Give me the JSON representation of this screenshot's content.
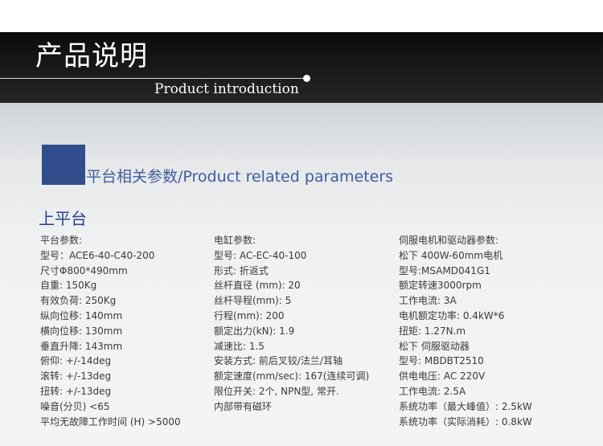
{
  "header": {
    "title_cn": "产品说明",
    "title_en": "Product introduction"
  },
  "section": {
    "title": "平台相关参数/Product related parameters",
    "subtitle": "上平台"
  },
  "columns": [
    {
      "lines": [
        "平台参数:",
        "型号：ACE6-40-C40-200",
        "尺寸Φ800*490mm",
        "自重: 150Kg",
        "有效负荷: 250Kg",
        "纵向位移: 140mm",
        "横向位移: 130mm",
        "垂直升降: 143mm",
        "俯仰: +/-14deg",
        "滚转: +/-13deg",
        "扭转: +/-13deg",
        "噪音(分贝) <65",
        "平均无故障工作时间 (H) >5000"
      ]
    },
    {
      "lines": [
        "电缸参数:",
        "型号: AC-EC-40-100",
        "形式: 折返式",
        "丝杆直径 (mm): 20",
        "丝杆导程(mm): 5",
        "行程(mm): 200",
        "额定出力(kN): 1.9",
        "减速比: 1.5",
        "安装方式: 前后叉铰/法兰/耳轴",
        "额定速度(mm/sec): 167(连续可调)",
        "限位开关: 2个, NPN型, 常开.",
        "内部带有磁环"
      ]
    },
    {
      "lines": [
        "伺服电机和驱动器参数:",
        "松下 400W-60mm电机",
        "型号:MSAMD041G1",
        "额定转速3000rpm",
        "工作电流: 3A",
        "电机额定功率: 0.4kW*6",
        "扭矩: 1.27N.m",
        "松下 伺服驱动器",
        "型号: MBDBT2510",
        "供电电压: AC 220V",
        "工作电流: 2.5A",
        "系统功率（最大峰值）: 2.5kW",
        "系统功率（实际消耗）: 0.8kW"
      ]
    }
  ],
  "colors": {
    "header_bg": "#141414",
    "accent_block": "#324d8c",
    "section_title": "#3f5d9e",
    "subsection_title": "#2a3f8f",
    "body_text": "#3a3a3a"
  }
}
